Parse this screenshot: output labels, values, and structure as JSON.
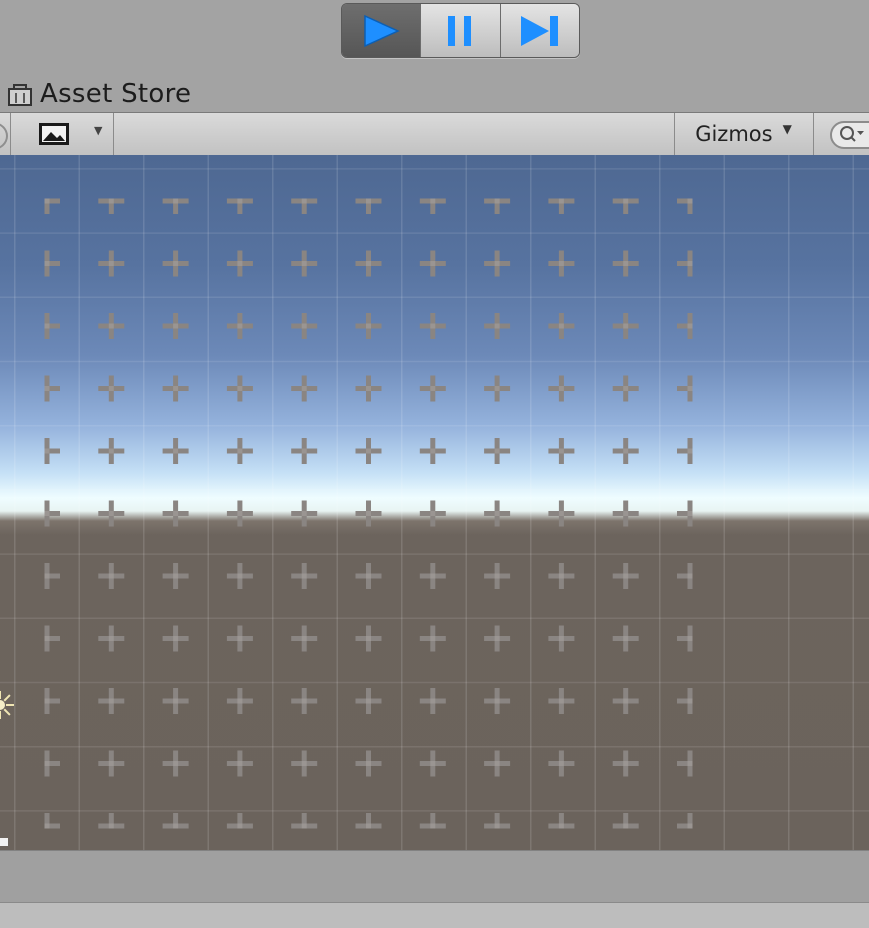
{
  "play_controls": {
    "play": {
      "icon": "play-icon",
      "active": true,
      "color": "#1e8fff"
    },
    "pause": {
      "icon": "pause-icon",
      "active": false
    },
    "step": {
      "icon": "step-icon",
      "active": false
    }
  },
  "tabs": [
    {
      "label": "Asset Store",
      "icon": "shopping-bag-icon"
    }
  ],
  "scene_toolbar": {
    "render_mode_icon": "image-icon",
    "gizmos_label": "Gizmos",
    "search_icon": "search-icon"
  },
  "scene": {
    "sky_color": "#5773a0",
    "horizon_color": "#effdff",
    "ground_color": "#6b635c",
    "tile_grid": {
      "columns": 11,
      "rows": 11
    },
    "light_icon": "sun-icon"
  }
}
